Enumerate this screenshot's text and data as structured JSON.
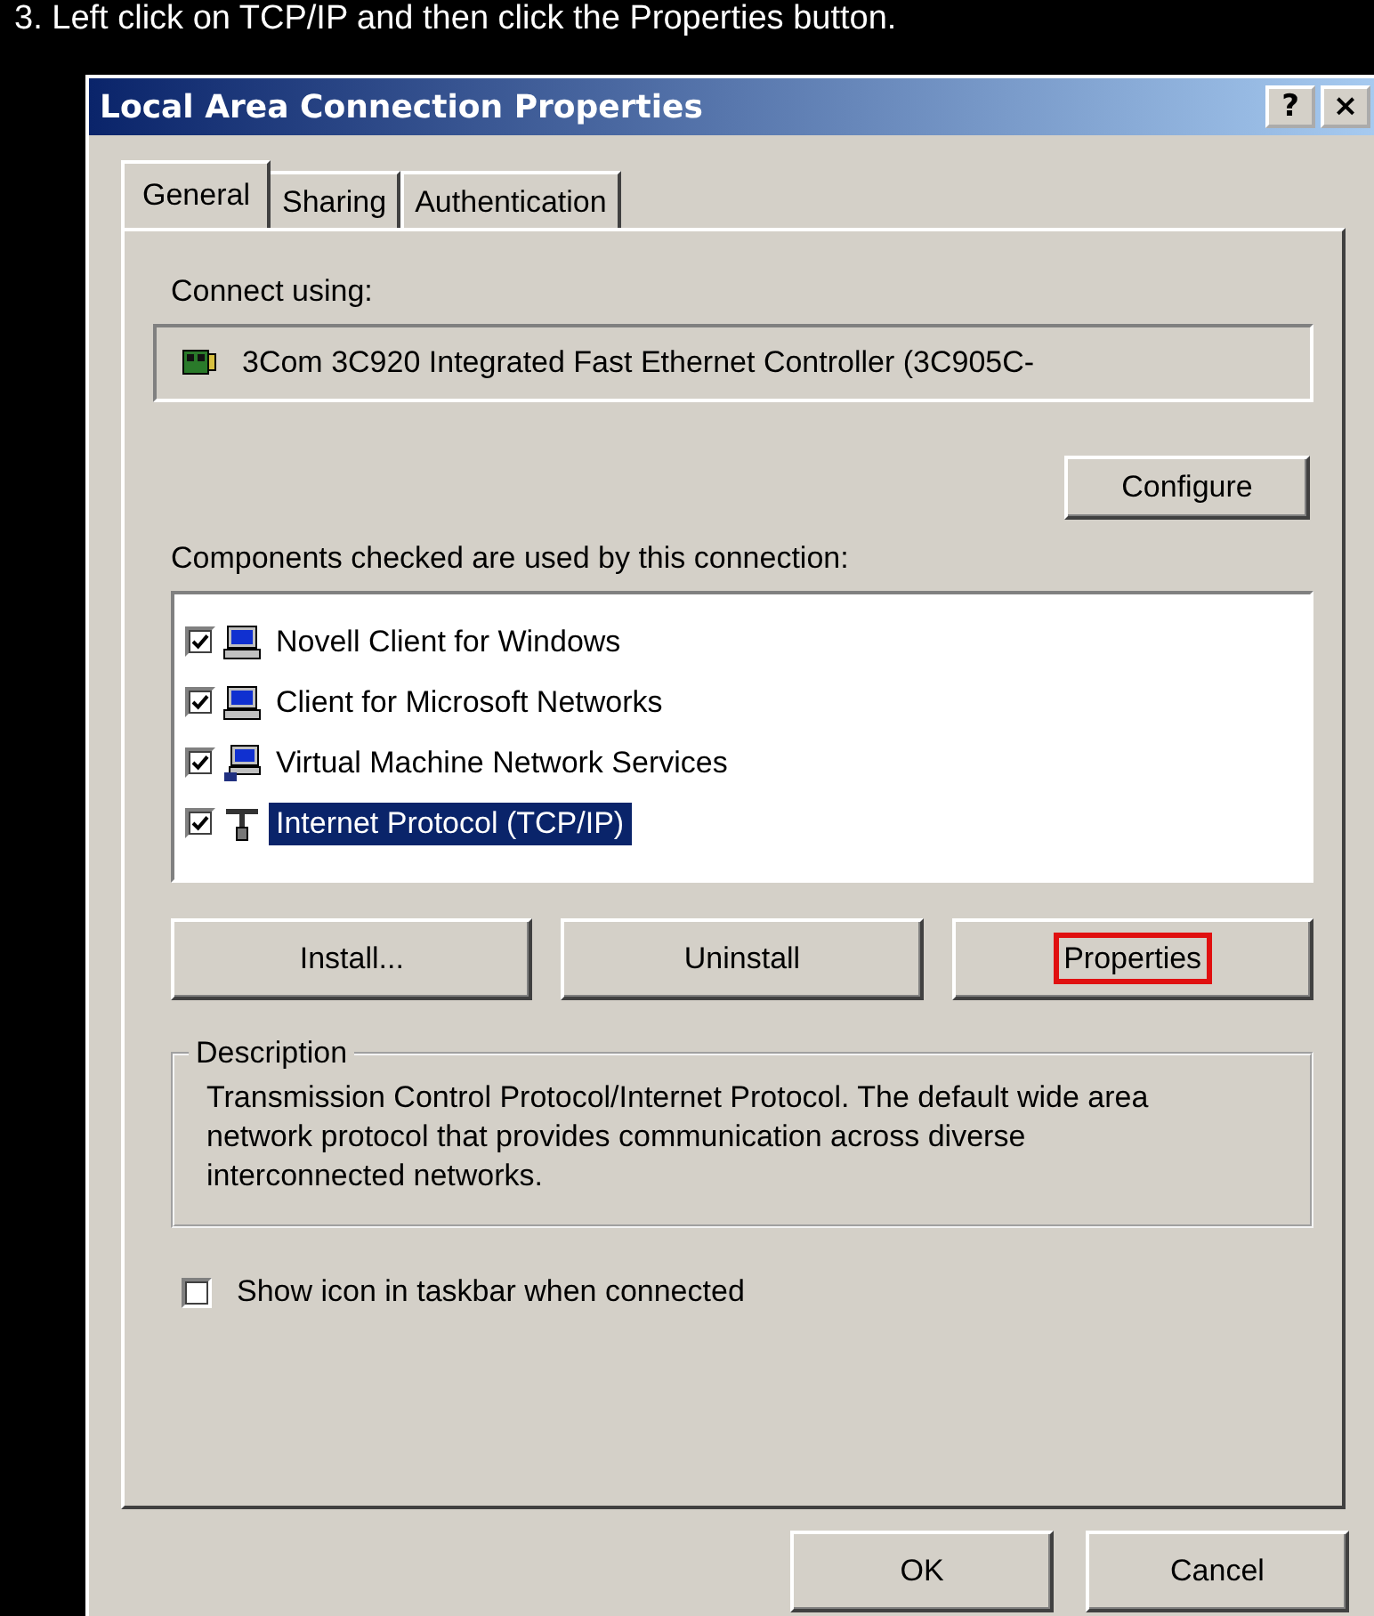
{
  "caption": "3. Left click on TCP/IP and then click the Properties button.",
  "window": {
    "title": "Local Area Connection Properties",
    "help_button": "?",
    "close_button": "×"
  },
  "tabs": [
    {
      "label": "General",
      "selected": true
    },
    {
      "label": "Sharing",
      "selected": false
    },
    {
      "label": "Authentication",
      "selected": false
    }
  ],
  "connect_using": {
    "label": "Connect using:",
    "adapter": "3Com 3C920 Integrated Fast Ethernet Controller (3C905C-",
    "configure_button": "Configure"
  },
  "components": {
    "label": "Components checked are used by this connection:",
    "items": [
      {
        "label": "Novell Client for Windows",
        "kind": "client",
        "checked": true,
        "selected": false
      },
      {
        "label": "Client for Microsoft Networks",
        "kind": "client",
        "checked": true,
        "selected": false
      },
      {
        "label": "Virtual Machine Network Services",
        "kind": "service",
        "checked": true,
        "selected": false
      },
      {
        "label": "Internet Protocol (TCP/IP)",
        "kind": "protocol",
        "checked": true,
        "selected": true
      }
    ]
  },
  "component_buttons": [
    {
      "label": "Install...",
      "highlighted": false
    },
    {
      "label": "Uninstall",
      "highlighted": false
    },
    {
      "label": "Properties",
      "highlighted": true
    }
  ],
  "description": {
    "title": "Description",
    "text": "Transmission Control Protocol/Internet Protocol. The default wide area network protocol that provides communication across diverse interconnected networks."
  },
  "show_icon": {
    "label": "Show icon in taskbar when connected",
    "checked": false
  },
  "dialog_buttons": [
    "OK",
    "Cancel"
  ]
}
